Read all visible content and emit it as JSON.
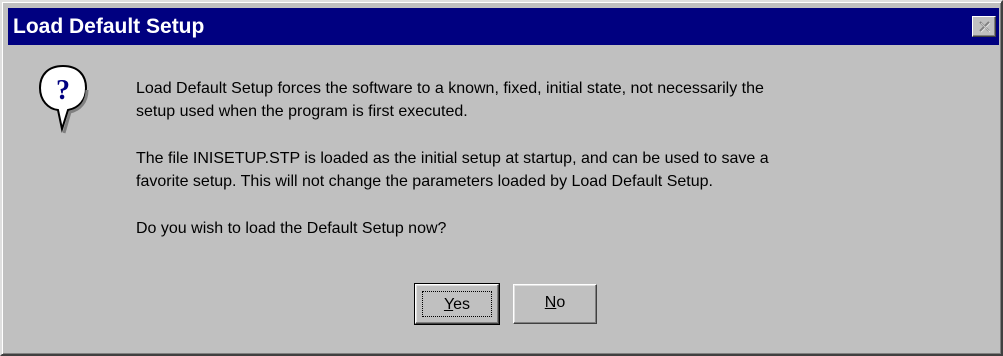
{
  "window": {
    "title": "Load Default Setup"
  },
  "icon": "question-balloon-icon",
  "message": {
    "paragraph1_line1": "Load Default Setup forces the software to a known, fixed, initial state, not necessarily the",
    "paragraph1_line2": "setup used when the program is first executed.",
    "paragraph2_line1": "The file INISETUP.STP is loaded as the initial setup at startup, and can be used to save a",
    "paragraph2_line2": "favorite setup.  This will not change the parameters loaded by Load Default Setup.",
    "paragraph3": "Do you wish to load the Default Setup now?"
  },
  "buttons": {
    "yes": {
      "mnemonic": "Y",
      "rest": "es"
    },
    "no": {
      "mnemonic": "N",
      "rest": "o"
    }
  },
  "colors": {
    "titlebar": "#000080",
    "face": "#c0c0c0",
    "icon_question": "#000080"
  }
}
